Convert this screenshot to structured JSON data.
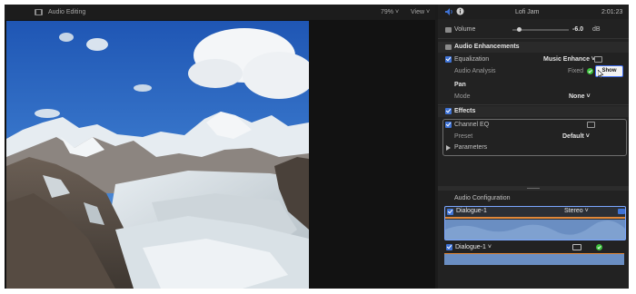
{
  "viewer": {
    "title": "Audio Editing",
    "zoom": "79%",
    "view": "View"
  },
  "inspector": {
    "clip_title": "Lofi Jam",
    "timecode": "2:01:23",
    "volume": {
      "label": "Volume",
      "value": "-6.0",
      "unit": "dB",
      "level": 0.08
    },
    "audio_enhancements": {
      "title": "Audio Enhancements",
      "equalization": {
        "label": "Equalization",
        "value": "Music Enhance"
      },
      "audio_analysis": {
        "label": "Audio Analysis",
        "value": "Fixed",
        "button": "Show"
      }
    },
    "pan": {
      "title": "Pan",
      "mode": {
        "label": "Mode",
        "value": "None"
      }
    },
    "effects": {
      "title": "Effects",
      "channel_eq": "Channel EQ",
      "preset": {
        "label": "Preset",
        "value": "Default"
      },
      "parameters": "Parameters"
    },
    "audio_configuration": {
      "title": "Audio Configuration",
      "lanes": [
        {
          "name": "Dialogue-1",
          "mode": "Stereo"
        },
        {
          "name": "Dialogue-1"
        }
      ]
    }
  },
  "colors": {
    "checkbox": "#3f73d6",
    "highlight": "#3e6df2",
    "waveform": "#6a8ec2",
    "green_check": "#3bbf3b",
    "orange_line": "#e0883a"
  }
}
